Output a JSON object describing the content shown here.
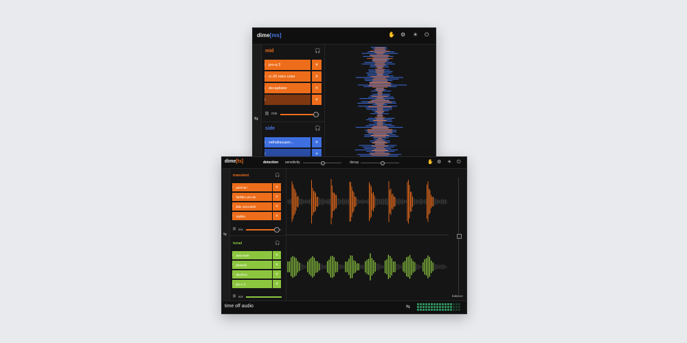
{
  "ms_window": {
    "title_main": "dime",
    "title_bracket": "[ms]",
    "mid": {
      "label": "mid",
      "plugins": [
        "pro-q 3",
        "rc-20 retro color",
        "decapitator",
        ""
      ],
      "mix_label": "mix",
      "mix_value": 0.9
    },
    "side": {
      "label": "side",
      "plugins": [
        "valhallasuper...",
        ""
      ]
    }
  },
  "ts_window": {
    "title_main": "dime",
    "title_bracket": "[ts]",
    "params": {
      "detection_label": "detection",
      "sensitivity_label": "sensitivity",
      "sensitivity_value": 0.5,
      "decay_label": "decay",
      "decay_value": 0.55
    },
    "transient": {
      "label": "transient",
      "plugins": [
        "panman",
        "fabfilter pro-ds",
        "little microshift",
        "replika"
      ],
      "mix_label": "mix",
      "mix_value": 0.85
    },
    "tonal": {
      "label": "tonal",
      "plugins": [
        "auto-tune",
        "phoenix",
        "devil-loc",
        "pro-c 2"
      ],
      "mix_label": "mix",
      "mix_value": 1.0
    },
    "balance_label": "balance",
    "brand": "time off audio"
  },
  "icons": {
    "headphones": "headphones-icon",
    "settings": "gear-icon",
    "sun": "sun-icon",
    "power": "power-icon",
    "hand": "grab-icon",
    "swap": "swap-icon",
    "link": "link-icon"
  },
  "colors": {
    "orange": "#ee6d1a",
    "blue": "#3d6fe0",
    "green": "#8cc63f",
    "background": "#151516"
  }
}
